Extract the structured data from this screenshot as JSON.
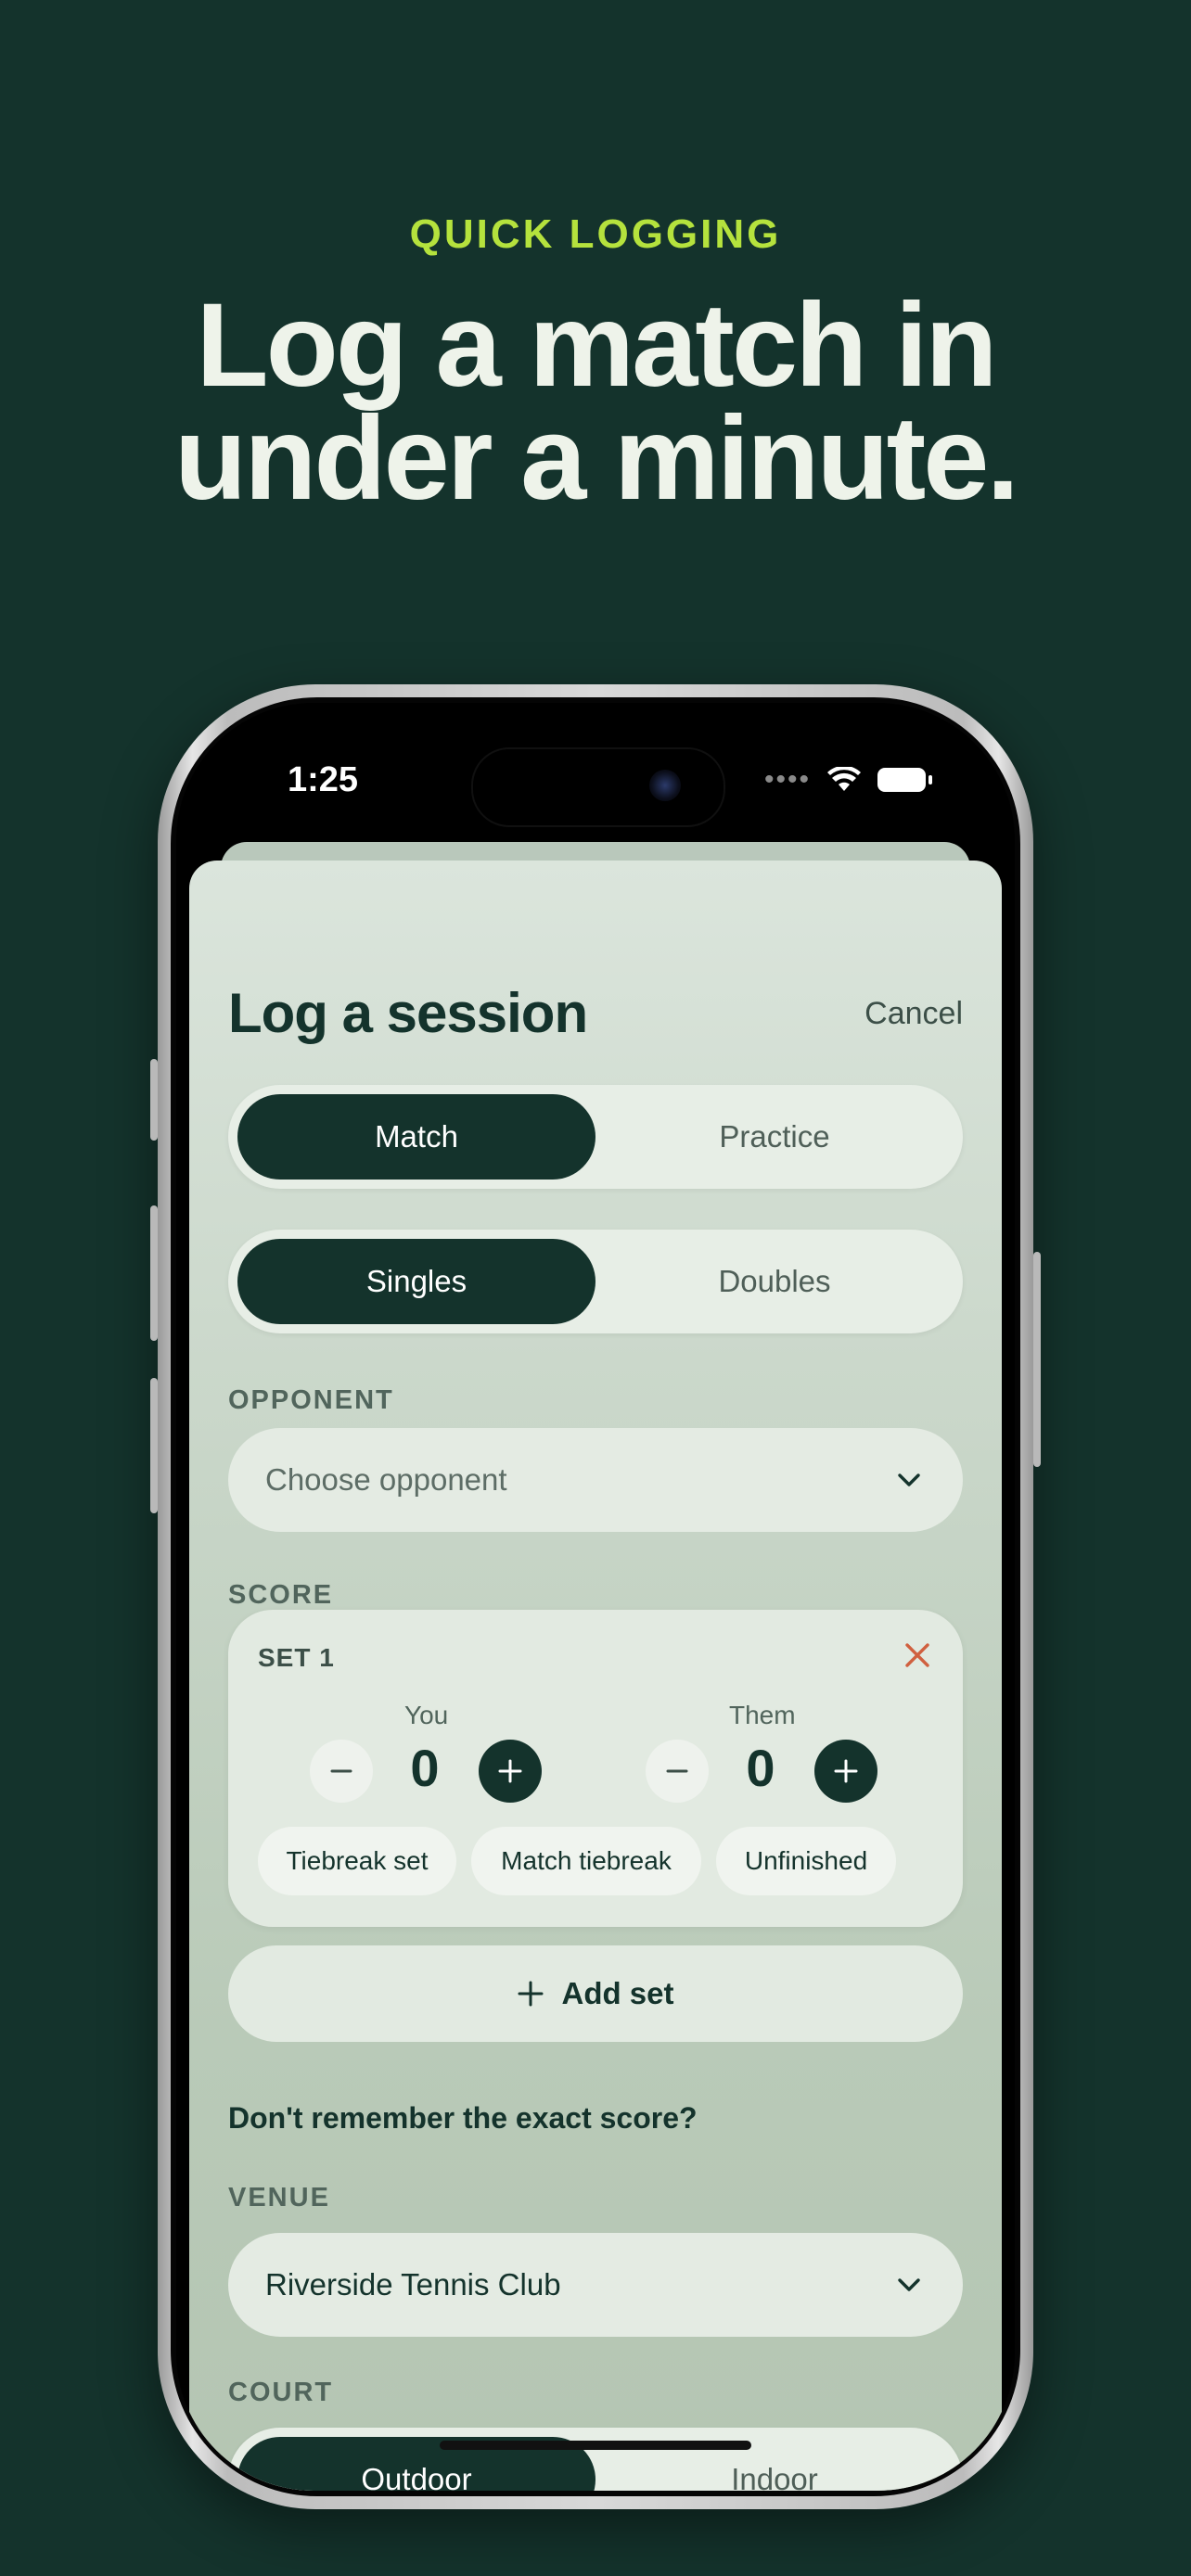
{
  "marketing": {
    "eyebrow": "QUICK LOGGING",
    "headline_line1": "Log a match in",
    "headline_line2": "under a minute."
  },
  "status_bar": {
    "time": "1:25",
    "icons": [
      "signal-dots-icon",
      "wifi-icon",
      "battery-icon"
    ]
  },
  "sheet": {
    "title": "Log a session",
    "cancel_label": "Cancel",
    "session_type": {
      "options": [
        "Match",
        "Practice"
      ],
      "selected": "Match"
    },
    "format": {
      "options": [
        "Singles",
        "Doubles"
      ],
      "selected": "Singles"
    },
    "opponent": {
      "label": "OPPONENT",
      "placeholder": "Choose opponent"
    },
    "score": {
      "label": "SCORE",
      "sets": [
        {
          "label": "SET 1",
          "you_label": "You",
          "them_label": "Them",
          "you_score": "0",
          "them_score": "0",
          "chips": [
            "Tiebreak set",
            "Match tiebreak",
            "Unfinished"
          ]
        }
      ],
      "add_set_label": "Add set"
    },
    "dont_remember": "Don't remember the exact score?",
    "venue": {
      "label": "VENUE",
      "value": "Riverside Tennis Club"
    },
    "court": {
      "label": "COURT",
      "options": [
        "Outdoor",
        "Indoor"
      ],
      "selected": "Outdoor"
    }
  },
  "colors": {
    "background": "#14332c",
    "accent": "#b5e23d",
    "primary": "#14332c",
    "danger": "#d0603f"
  }
}
